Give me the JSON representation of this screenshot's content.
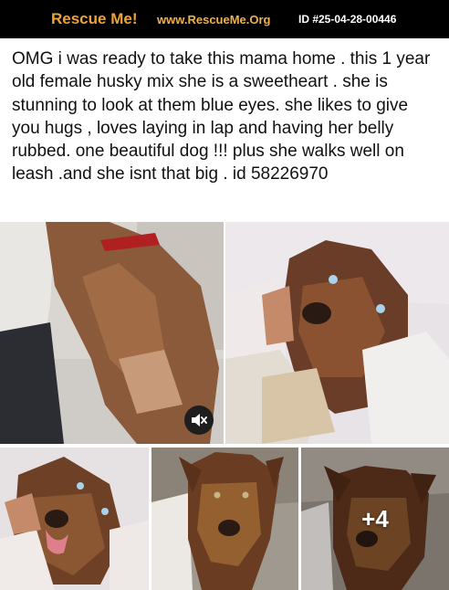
{
  "header": {
    "brand": "Rescue Me!",
    "site": "www.RescueMe.Org",
    "id": "ID #25-04-28-00446"
  },
  "post": {
    "text": "OMG i was ready to take this mama home . this 1 year old female husky mix she is a sweetheart . she is stunning to look at them blue eyes. she likes to give you hugs , loves laying in lap and having her belly rubbed. one beautiful dog !!! plus she walks well on leash .and she isnt that big . id 58226970"
  },
  "photos": {
    "more_count": "+4",
    "video_icon": "speaker-muted-icon"
  },
  "colors": {
    "brand": "#f0a238",
    "header_bg": "#000000",
    "text": "#111111"
  }
}
